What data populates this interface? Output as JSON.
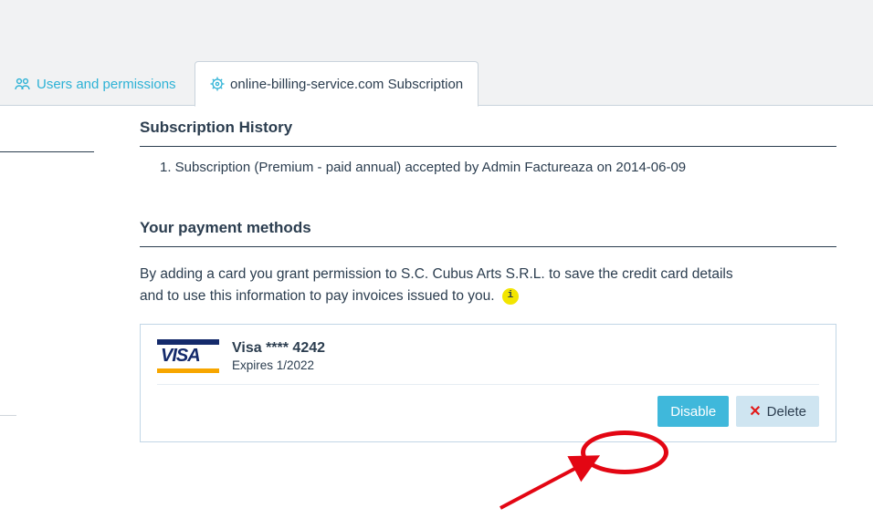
{
  "tabs": {
    "users": "Users and permissions",
    "subscription": "online-billing-service.com Subscription"
  },
  "history": {
    "heading": "Subscription History",
    "items": [
      "1. Subscription (Premium - paid annual) accepted by Admin Factureaza on 2014-06-09"
    ]
  },
  "payment": {
    "heading": "Your payment methods",
    "desc_line1": "By adding a card you grant permission to S.C. Cubus Arts S.R.L. to save the credit card details",
    "desc_line2": "and to use this information to pay invoices issued to you.",
    "info_glyph": "i",
    "card": {
      "brand_logo_text": "VISA",
      "name": "Visa **** 4242",
      "expires": "Expires 1/2022"
    },
    "actions": {
      "disable": "Disable",
      "delete": "Delete"
    }
  }
}
